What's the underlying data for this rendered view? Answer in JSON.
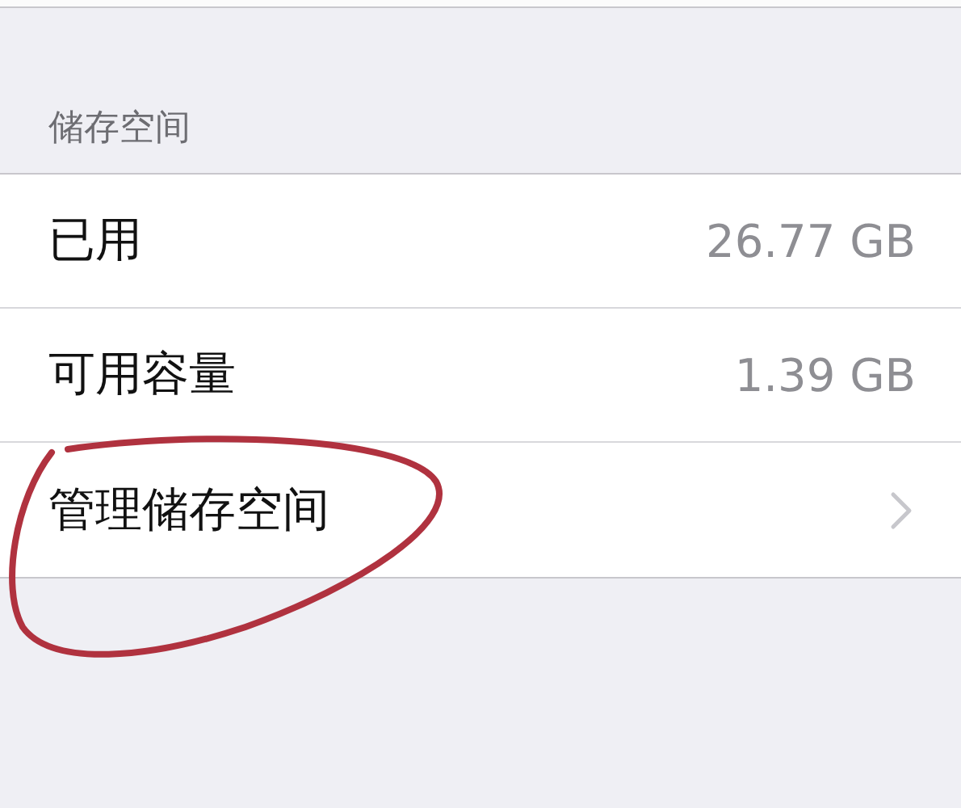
{
  "section": {
    "header": "储存空间",
    "rows": [
      {
        "kind": "value",
        "label": "已用",
        "value": "26.77 GB"
      },
      {
        "kind": "value",
        "label": "可用容量",
        "value": "1.39 GB"
      },
      {
        "kind": "link",
        "label": "管理储存空间"
      }
    ]
  }
}
